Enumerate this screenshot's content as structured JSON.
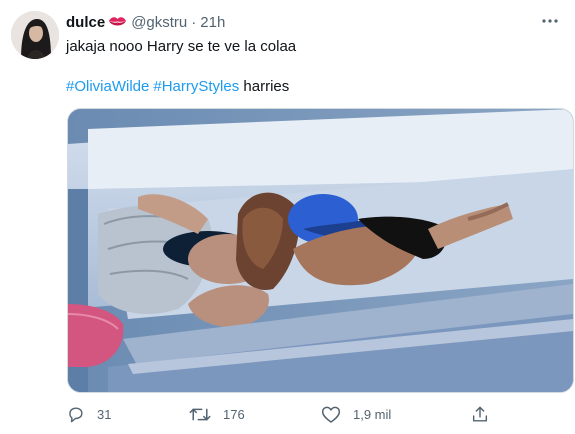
{
  "tweet": {
    "author_name": "dulce",
    "name_emoji_icon": "kiss-mark-icon",
    "handle": "@gkstru",
    "separator": "·",
    "time": "21h",
    "text": "jakaja nooo Harry se te ve la colaa",
    "hashtags": [
      "#OliviaWilde",
      "#HarryStyles"
    ],
    "trailing_word": "harries",
    "media_icon": "beach-photo",
    "colors": {
      "hashtag": "#1d9bf0",
      "secondary_text": "#536471",
      "primary_text": "#0f1419"
    }
  },
  "actions": {
    "reply_count": "31",
    "retweet_count": "176",
    "like_count": "1,9 mil",
    "share_label": ""
  }
}
